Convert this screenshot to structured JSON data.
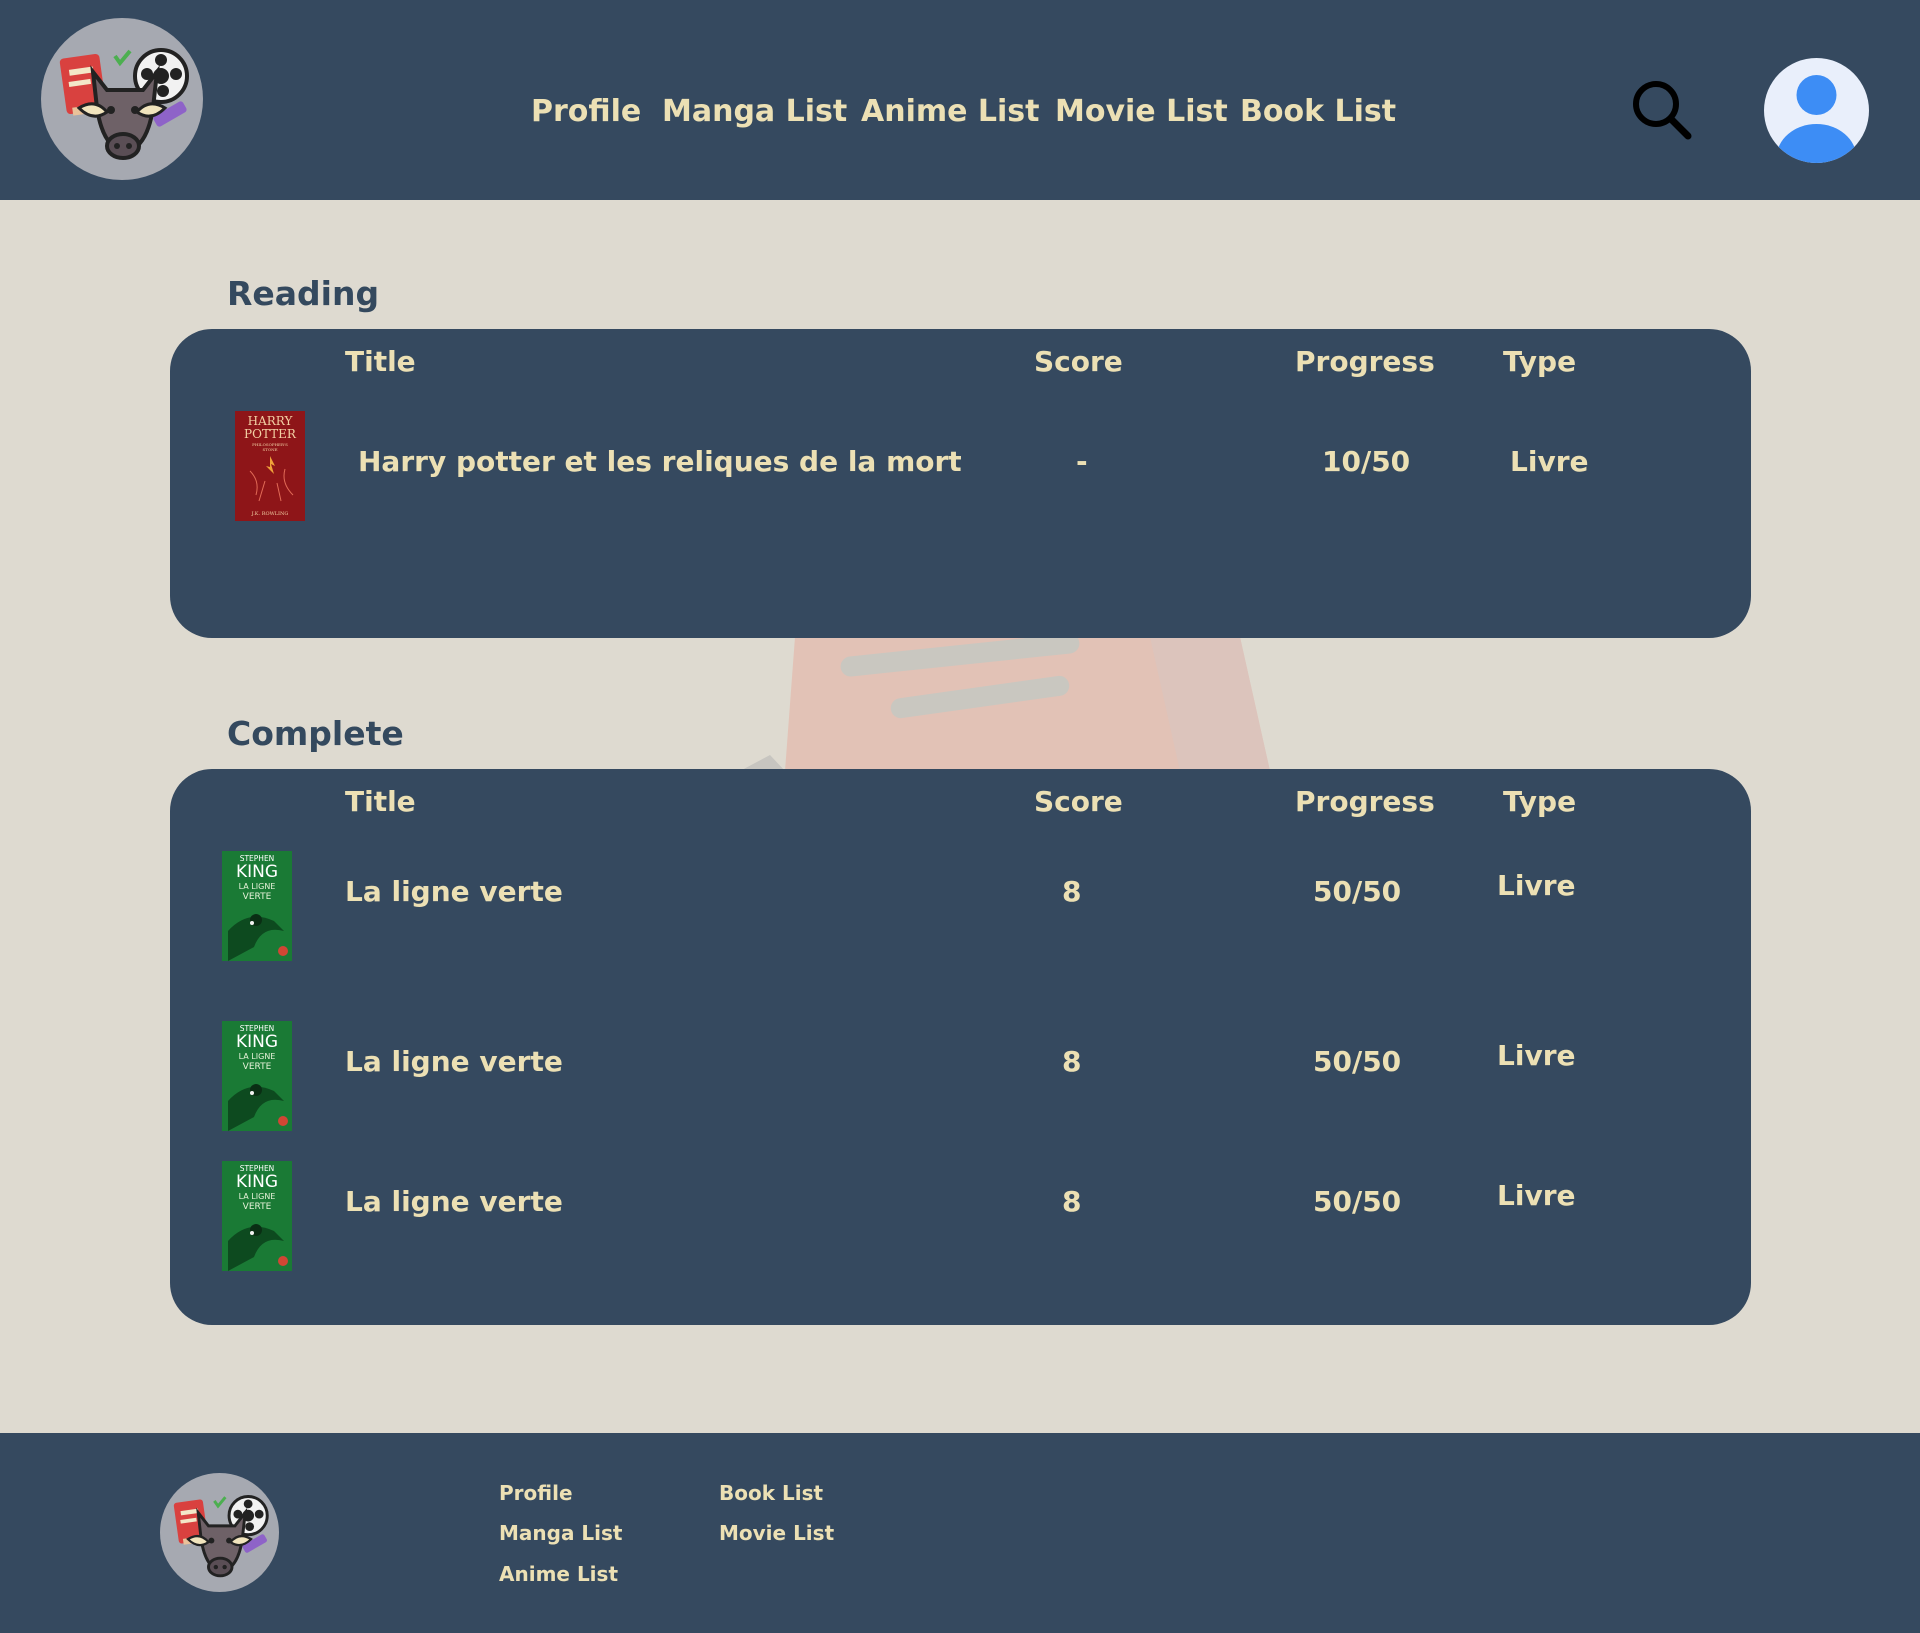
{
  "header": {
    "nav": [
      {
        "label": "Profile"
      },
      {
        "label": "Manga List"
      },
      {
        "label": "Anime List"
      },
      {
        "label": "Movie List"
      },
      {
        "label": "Book List"
      }
    ]
  },
  "sections": [
    {
      "title": "Reading",
      "columns": {
        "title": "Title",
        "score": "Score",
        "progress": "Progress",
        "type": "Type"
      },
      "rows": [
        {
          "cover": "harry-potter-cover",
          "cover_text": [
            "HARRY",
            "POTTER",
            "PHILOSOPHER'S",
            "STONE",
            "J.K. ROWLING"
          ],
          "title": "Harry potter et les reliques de la mort",
          "score": "-",
          "progress": "10/50",
          "type": "Livre"
        }
      ]
    },
    {
      "title": "Complete",
      "columns": {
        "title": "Title",
        "score": "Score",
        "progress": "Progress",
        "type": "Type"
      },
      "rows": [
        {
          "cover": "la-ligne-verte-cover",
          "cover_text": [
            "STEPHEN",
            "KING",
            "LA LIGNE",
            "VERTE"
          ],
          "title": "La ligne verte",
          "score": "8",
          "progress": "50/50",
          "type": "Livre"
        },
        {
          "cover": "la-ligne-verte-cover",
          "cover_text": [
            "STEPHEN",
            "KING",
            "LA LIGNE",
            "VERTE"
          ],
          "title": "La ligne verte",
          "score": "8",
          "progress": "50/50",
          "type": "Livre"
        },
        {
          "cover": "la-ligne-verte-cover",
          "cover_text": [
            "STEPHEN",
            "KING",
            "LA LIGNE",
            "VERTE"
          ],
          "title": "La ligne verte",
          "score": "8",
          "progress": "50/50",
          "type": "Livre"
        }
      ]
    }
  ],
  "footer": {
    "links": [
      {
        "label": "Profile"
      },
      {
        "label": "Manga List"
      },
      {
        "label": "Anime List"
      },
      {
        "label": "Book List"
      },
      {
        "label": "Movie List"
      }
    ]
  },
  "colors": {
    "navy": "#35495f",
    "background": "#dedad0",
    "accent_text": "#ece0b4",
    "avatar_blue": "#3d8df5"
  },
  "icons": [
    "boar-logo-icon",
    "search-icon",
    "user-avatar-icon"
  ]
}
